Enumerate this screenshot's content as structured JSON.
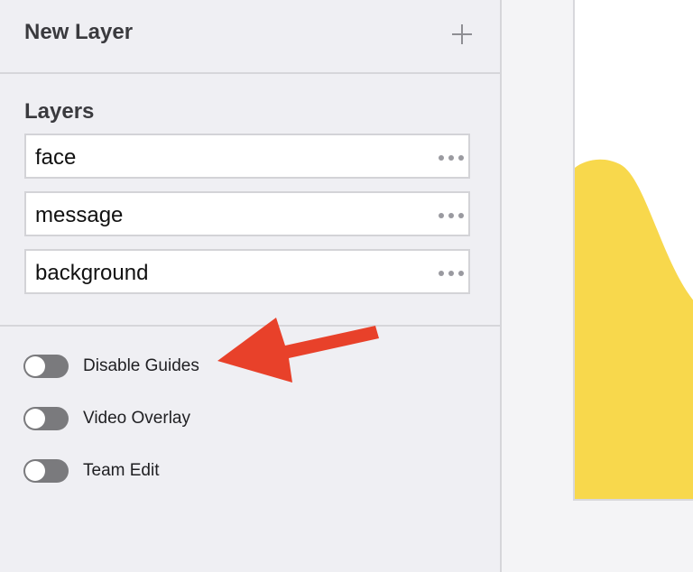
{
  "new_layer": {
    "title": "New Layer",
    "add_icon": "plus-icon"
  },
  "layers": {
    "title": "Layers",
    "more_icon": "ellipsis-icon",
    "items": [
      {
        "name": "face"
      },
      {
        "name": "message"
      },
      {
        "name": "background"
      }
    ]
  },
  "settings": {
    "toggles": [
      {
        "label": "Disable Guides",
        "on": false
      },
      {
        "label": "Video Overlay",
        "on": false
      },
      {
        "label": "Team Edit",
        "on": false
      }
    ]
  },
  "colors": {
    "sidebar_bg": "#efeff3",
    "toggle_off": "#7a7a7d",
    "shape_yellow": "#f8d84c",
    "arrow_red": "#e8412a"
  }
}
